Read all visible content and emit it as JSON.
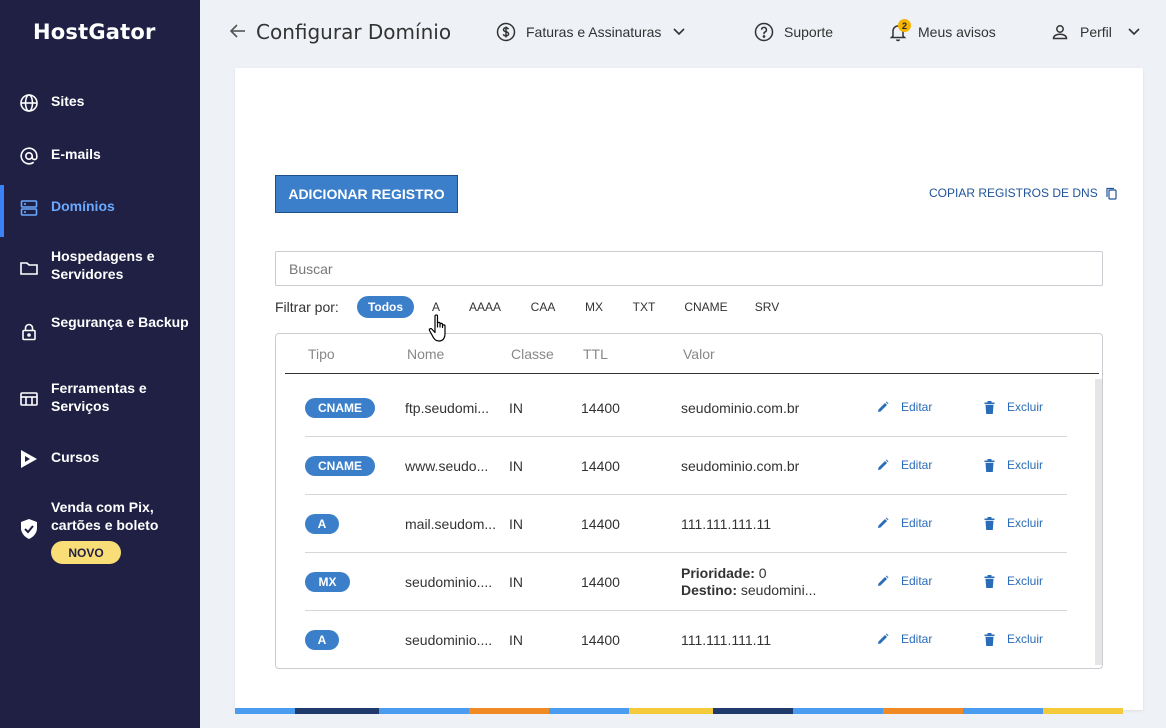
{
  "brand": "HostGator",
  "sidebar": {
    "items": [
      {
        "label": "Sites",
        "icon": "globe-icon"
      },
      {
        "label": "E-mails",
        "icon": "at-icon"
      },
      {
        "label": "Domínios",
        "icon": "server-icon"
      },
      {
        "label": "Hospedagens e Servidores",
        "icon": "folder-icon"
      },
      {
        "label": "Segurança e Backup",
        "icon": "lock-icon"
      },
      {
        "label": "Ferramentas e Serviços",
        "icon": "tools-icon"
      },
      {
        "label": "Cursos",
        "icon": "play-icon"
      },
      {
        "label": "Venda com Pix, cartões e boleto",
        "icon": "shield-check-icon"
      }
    ],
    "active": "Domínios",
    "badge": "NOVO"
  },
  "header": {
    "title": "Configurar Domínio",
    "billing": "Faturas e Assinaturas",
    "support": "Suporte",
    "notices": "Meus avisos",
    "notices_count": "2",
    "profile": "Perfil"
  },
  "main": {
    "add_button": "ADICIONAR REGISTRO",
    "copy_link": "COPIAR REGISTROS DE DNS",
    "search_placeholder": "Buscar",
    "filter_label": "Filtrar por:",
    "filters": [
      "Todos",
      "A",
      "AAAA",
      "CAA",
      "MX",
      "TXT",
      "CNAME",
      "SRV"
    ],
    "active_filter": "Todos",
    "columns": [
      "Tipo",
      "Nome",
      "Classe",
      "TTL",
      "Valor"
    ],
    "edit_label": "Editar",
    "delete_label": "Excluir",
    "rows": [
      {
        "type": "CNAME",
        "name": "ftp.seudomi...",
        "class": "IN",
        "ttl": "14400",
        "value": "seudominio.com.br"
      },
      {
        "type": "CNAME",
        "name": "www.seudo...",
        "class": "IN",
        "ttl": "14400",
        "value": "seudominio.com.br"
      },
      {
        "type": "A",
        "name": "mail.seudom...",
        "class": "IN",
        "ttl": "14400",
        "value": "111.111.111.11"
      },
      {
        "type": "MX",
        "name": "seudominio....",
        "class": "IN",
        "ttl": "14400",
        "priority_label": "Prioridade:",
        "priority": "0",
        "dest_label": "Destino:",
        "dest": "seudomini..."
      },
      {
        "type": "A",
        "name": "seudominio....",
        "class": "IN",
        "ttl": "14400",
        "value": "111.111.111.11"
      }
    ]
  },
  "colors": {
    "sidebar_bg": "#1f2044",
    "accent": "#3b7fcb",
    "active_nav": "#6aa9ff",
    "badge": "#f9dd76",
    "link": "#2b6cb8"
  }
}
